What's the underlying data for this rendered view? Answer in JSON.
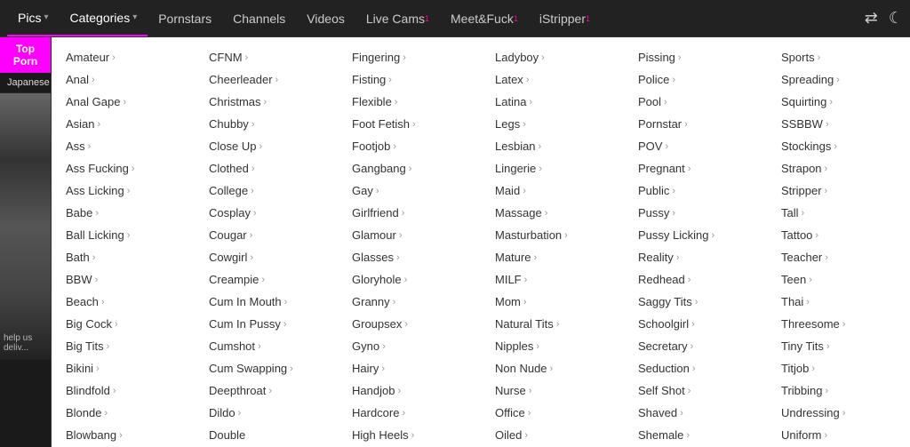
{
  "navbar": {
    "logo": "Pics",
    "items": [
      {
        "label": "Categories",
        "hasDropdown": true,
        "active": true
      },
      {
        "label": "Pornstars",
        "hasDropdown": false
      },
      {
        "label": "Channels",
        "hasDropdown": false
      },
      {
        "label": "Videos",
        "hasDropdown": false
      },
      {
        "label": "Live Cams",
        "hasDropdown": false,
        "sup": "1"
      },
      {
        "label": "Meet&Fuck",
        "hasDropdown": false,
        "sup": "1"
      },
      {
        "label": "iStripper",
        "hasDropdown": false,
        "sup": "1"
      }
    ]
  },
  "sidebar": {
    "top": "Top Porn",
    "items": [
      "Japanese"
    ]
  },
  "categories": [
    {
      "label": "Amateur",
      "hasArrow": true
    },
    {
      "label": "CFNM",
      "hasArrow": true
    },
    {
      "label": "Fingering",
      "hasArrow": true
    },
    {
      "label": "Ladyboy",
      "hasArrow": true
    },
    {
      "label": "Pissing",
      "hasArrow": true
    },
    {
      "label": "Sports",
      "hasArrow": true
    },
    {
      "label": "Anal",
      "hasArrow": true
    },
    {
      "label": "Cheerleader",
      "hasArrow": true
    },
    {
      "label": "Fisting",
      "hasArrow": true
    },
    {
      "label": "Latex",
      "hasArrow": true
    },
    {
      "label": "Police",
      "hasArrow": true
    },
    {
      "label": "Spreading",
      "hasArrow": true
    },
    {
      "label": "Anal Gape",
      "hasArrow": true
    },
    {
      "label": "Christmas",
      "hasArrow": true
    },
    {
      "label": "Flexible",
      "hasArrow": true
    },
    {
      "label": "Latina",
      "hasArrow": true
    },
    {
      "label": "Pool",
      "hasArrow": true
    },
    {
      "label": "Squirting",
      "hasArrow": true
    },
    {
      "label": "Asian",
      "hasArrow": true
    },
    {
      "label": "Chubby",
      "hasArrow": true
    },
    {
      "label": "Foot Fetish",
      "hasArrow": true
    },
    {
      "label": "Legs",
      "hasArrow": true
    },
    {
      "label": "Pornstar",
      "hasArrow": true
    },
    {
      "label": "SSBBW",
      "hasArrow": true
    },
    {
      "label": "Ass",
      "hasArrow": true
    },
    {
      "label": "Close Up",
      "hasArrow": true
    },
    {
      "label": "Footjob",
      "hasArrow": true
    },
    {
      "label": "Lesbian",
      "hasArrow": true
    },
    {
      "label": "POV",
      "hasArrow": true
    },
    {
      "label": "Stockings",
      "hasArrow": true
    },
    {
      "label": "Ass Fucking",
      "hasArrow": true
    },
    {
      "label": "Clothed",
      "hasArrow": true
    },
    {
      "label": "Gangbang",
      "hasArrow": true
    },
    {
      "label": "Lingerie",
      "hasArrow": true
    },
    {
      "label": "Pregnant",
      "hasArrow": true
    },
    {
      "label": "Strapon",
      "hasArrow": true
    },
    {
      "label": "Ass Licking",
      "hasArrow": true
    },
    {
      "label": "College",
      "hasArrow": true
    },
    {
      "label": "Gay",
      "hasArrow": true
    },
    {
      "label": "Maid",
      "hasArrow": true
    },
    {
      "label": "Public",
      "hasArrow": true
    },
    {
      "label": "Stripper",
      "hasArrow": true
    },
    {
      "label": "Babe",
      "hasArrow": true
    },
    {
      "label": "Cosplay",
      "hasArrow": true
    },
    {
      "label": "Girlfriend",
      "hasArrow": true
    },
    {
      "label": "Massage",
      "hasArrow": true
    },
    {
      "label": "Pussy",
      "hasArrow": true
    },
    {
      "label": "Tall",
      "hasArrow": true
    },
    {
      "label": "Ball Licking",
      "hasArrow": true
    },
    {
      "label": "Cougar",
      "hasArrow": true
    },
    {
      "label": "Glamour",
      "hasArrow": true
    },
    {
      "label": "Masturbation",
      "hasArrow": true
    },
    {
      "label": "Pussy Licking",
      "hasArrow": true
    },
    {
      "label": "Tattoo",
      "hasArrow": true
    },
    {
      "label": "Bath",
      "hasArrow": true
    },
    {
      "label": "Cowgirl",
      "hasArrow": true
    },
    {
      "label": "Glasses",
      "hasArrow": true
    },
    {
      "label": "Mature",
      "hasArrow": true
    },
    {
      "label": "Reality",
      "hasArrow": true
    },
    {
      "label": "Teacher",
      "hasArrow": true
    },
    {
      "label": "BBW",
      "hasArrow": true
    },
    {
      "label": "Creampie",
      "hasArrow": true
    },
    {
      "label": "Gloryhole",
      "hasArrow": true
    },
    {
      "label": "MILF",
      "hasArrow": true
    },
    {
      "label": "Redhead",
      "hasArrow": true
    },
    {
      "label": "Teen",
      "hasArrow": true
    },
    {
      "label": "Beach",
      "hasArrow": true
    },
    {
      "label": "Cum In Mouth",
      "hasArrow": true
    },
    {
      "label": "Granny",
      "hasArrow": true
    },
    {
      "label": "Mom",
      "hasArrow": true
    },
    {
      "label": "Saggy Tits",
      "hasArrow": true
    },
    {
      "label": "Thai",
      "hasArrow": true
    },
    {
      "label": "Big Cock",
      "hasArrow": true
    },
    {
      "label": "Cum In Pussy",
      "hasArrow": true
    },
    {
      "label": "Groupsex",
      "hasArrow": true
    },
    {
      "label": "Natural Tits",
      "hasArrow": true
    },
    {
      "label": "Schoolgirl",
      "hasArrow": true
    },
    {
      "label": "Threesome",
      "hasArrow": true
    },
    {
      "label": "Big Tits",
      "hasArrow": true
    },
    {
      "label": "Cumshot",
      "hasArrow": true
    },
    {
      "label": "Gyno",
      "hasArrow": true
    },
    {
      "label": "Nipples",
      "hasArrow": true
    },
    {
      "label": "Secretary",
      "hasArrow": true
    },
    {
      "label": "Tiny Tits",
      "hasArrow": true
    },
    {
      "label": "Bikini",
      "hasArrow": true
    },
    {
      "label": "Cum Swapping",
      "hasArrow": true
    },
    {
      "label": "Hairy",
      "hasArrow": true
    },
    {
      "label": "Non Nude",
      "hasArrow": true
    },
    {
      "label": "Seduction",
      "hasArrow": true
    },
    {
      "label": "Titjob",
      "hasArrow": true
    },
    {
      "label": "Blindfold",
      "hasArrow": true
    },
    {
      "label": "Deepthroat",
      "hasArrow": true
    },
    {
      "label": "Handjob",
      "hasArrow": true
    },
    {
      "label": "Nurse",
      "hasArrow": true
    },
    {
      "label": "Self Shot",
      "hasArrow": true
    },
    {
      "label": "Tribbing",
      "hasArrow": true
    },
    {
      "label": "Blonde",
      "hasArrow": true
    },
    {
      "label": "Dildo",
      "hasArrow": true
    },
    {
      "label": "Hardcore",
      "hasArrow": true
    },
    {
      "label": "Office",
      "hasArrow": true
    },
    {
      "label": "Shaved",
      "hasArrow": true
    },
    {
      "label": "Undressing",
      "hasArrow": true
    },
    {
      "label": "Blowbang",
      "hasArrow": true
    },
    {
      "label": "Double",
      "hasArrow": false
    },
    {
      "label": "High Heels",
      "hasArrow": true
    },
    {
      "label": "Oiled",
      "hasArrow": true
    },
    {
      "label": "Shemale",
      "hasArrow": true
    },
    {
      "label": "Uniform",
      "hasArrow": true
    }
  ]
}
